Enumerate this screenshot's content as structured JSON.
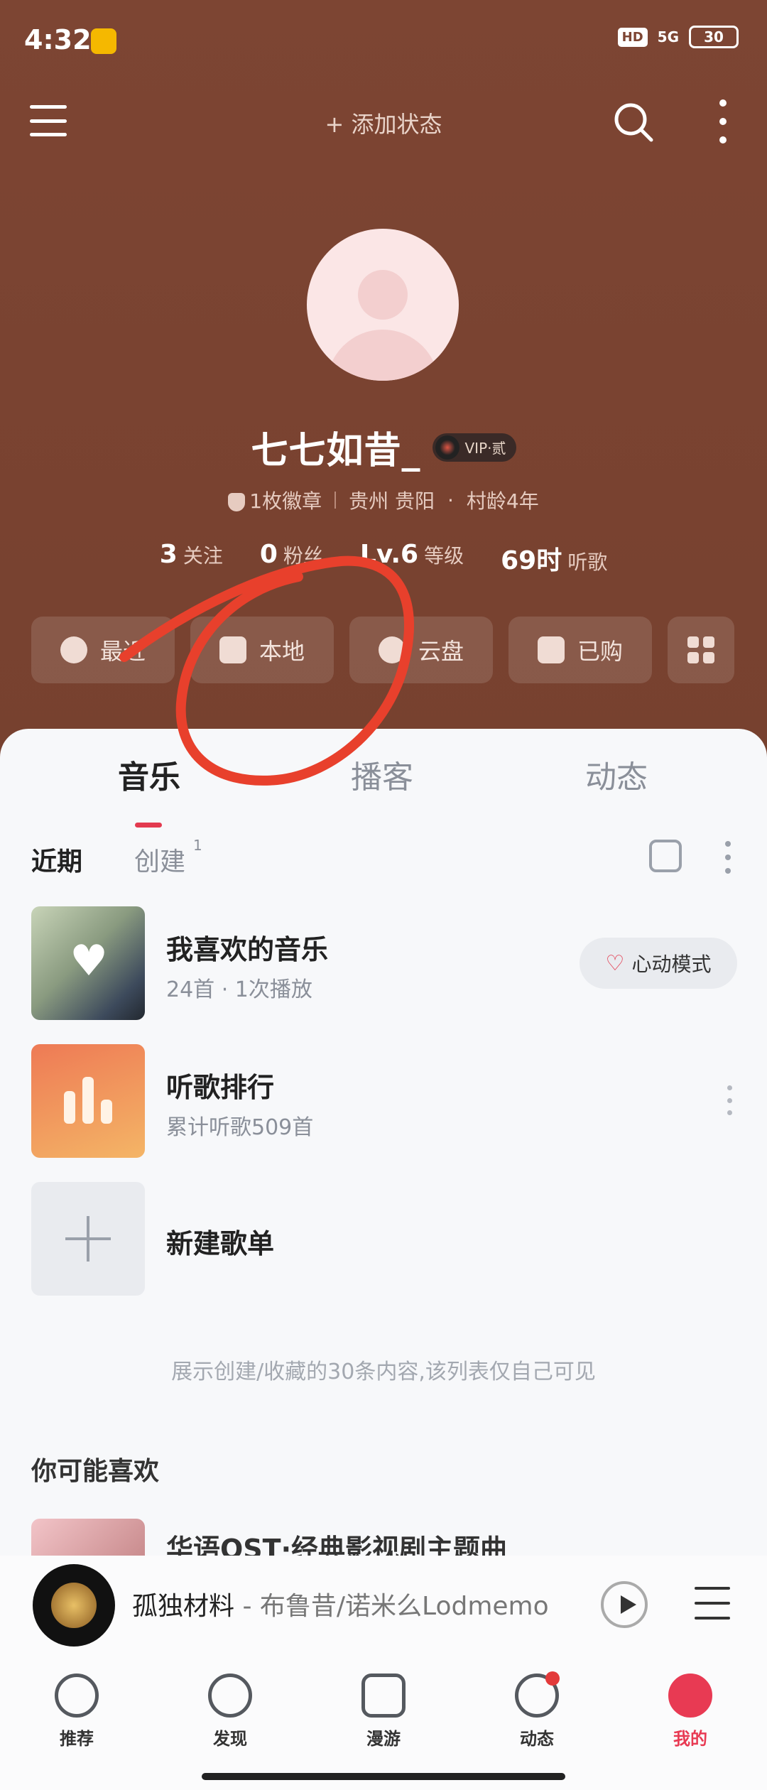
{
  "status_bar": {
    "time": "4:32",
    "hd": "HD",
    "network": "5G",
    "battery": "30"
  },
  "topbar": {
    "add_status": "+ 添加状态"
  },
  "profile": {
    "username": "七七如昔_",
    "vip_level": "VIP·贰",
    "badges": "1枚徽章",
    "location": "贵州 贵阳",
    "village_age": "村龄4年",
    "stats": [
      {
        "num": "3",
        "label": "关注"
      },
      {
        "num": "0",
        "label": "粉丝"
      },
      {
        "num": "Lv.6",
        "label": "等级"
      },
      {
        "num": "69时",
        "label": "听歌"
      }
    ]
  },
  "quick_actions": [
    {
      "label": "最近",
      "icon": "clock-icon"
    },
    {
      "label": "本地",
      "icon": "download-icon"
    },
    {
      "label": "云盘",
      "icon": "cloud-upload-icon"
    },
    {
      "label": "已购",
      "icon": "bag-icon"
    }
  ],
  "tabs": [
    "音乐",
    "播客",
    "动态"
  ],
  "subtabs": {
    "recent": "近期",
    "created": "创建",
    "created_count": "1"
  },
  "playlists": [
    {
      "title": "我喜欢的音乐",
      "subtitle": "24首 · 1次播放",
      "action": "心动模式"
    },
    {
      "title": "听歌排行",
      "subtitle": "累计听歌509首"
    },
    {
      "title": "新建歌单"
    }
  ],
  "hint": "展示创建/收藏的30条内容,该列表仅自己可见",
  "may_like": {
    "heading": "你可能喜欢",
    "first_title": "华语OST·经典影视剧主题曲"
  },
  "player": {
    "title": "孤独材料",
    "artist": " - 布鲁昔/诺米么Lodmemo"
  },
  "bottom_nav": [
    {
      "label": "推荐"
    },
    {
      "label": "发现"
    },
    {
      "label": "漫游"
    },
    {
      "label": "动态"
    },
    {
      "label": "我的"
    }
  ],
  "colors": {
    "header_bg": "#7d4533",
    "accent": "#e83a53",
    "annotation": "#e8402c"
  }
}
